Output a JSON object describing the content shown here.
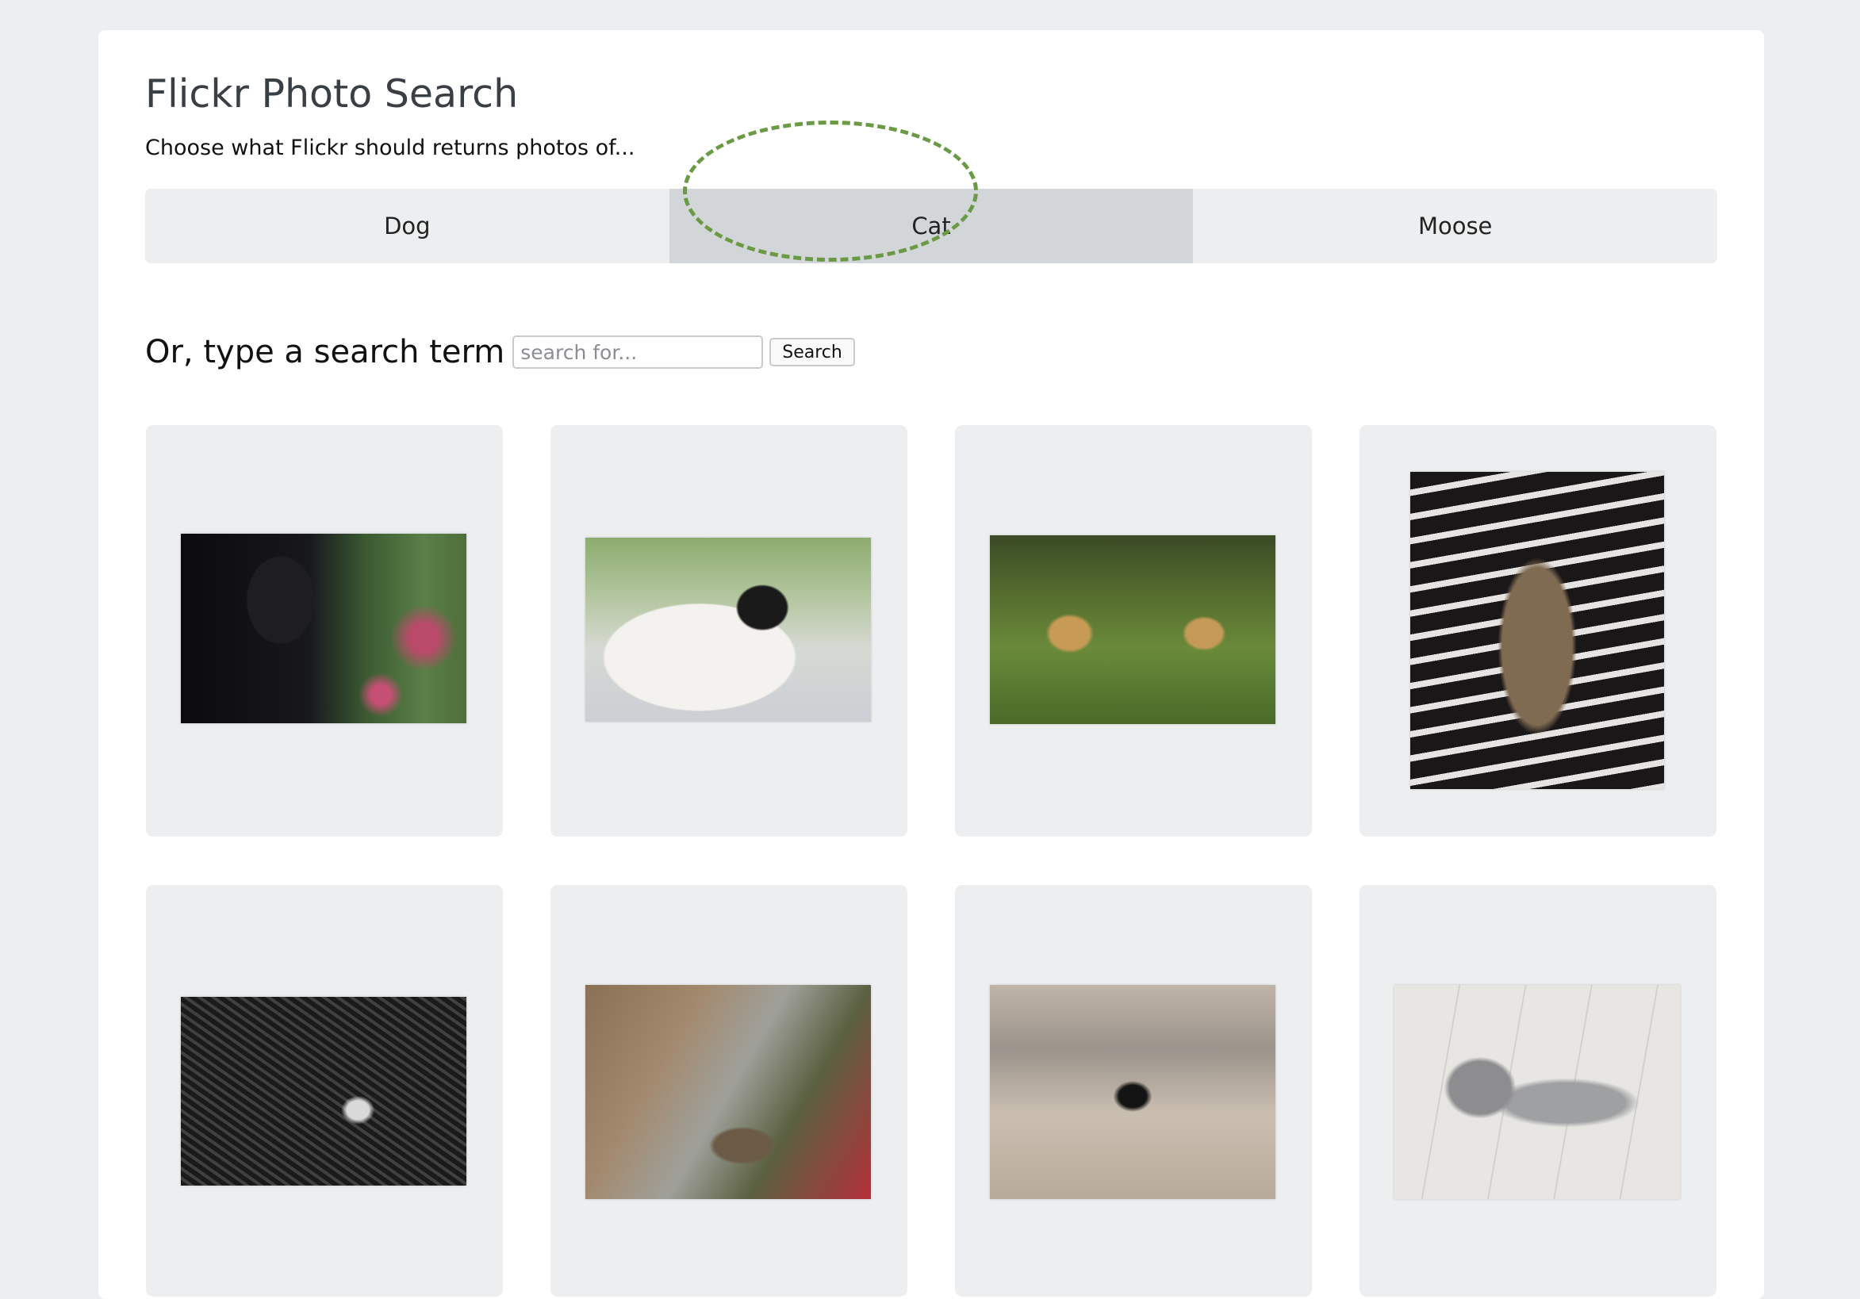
{
  "page": {
    "title": "Flickr Photo Search",
    "subtitle": "Choose what Flickr should returns photos of..."
  },
  "tabs": [
    {
      "label": "Dog",
      "active": false
    },
    {
      "label": "Cat",
      "active": true
    },
    {
      "label": "Moose",
      "active": false
    }
  ],
  "search": {
    "label": "Or, type a search term",
    "placeholder": "search for...",
    "value": "",
    "button_label": "Search"
  },
  "photos": [
    {
      "subject": "black cat"
    },
    {
      "subject": "white and black cat"
    },
    {
      "subject": "two leopards in grass"
    },
    {
      "subject": "tortoiseshell cat on striped blanket"
    },
    {
      "subject": "cat under wicker chair (black and white)"
    },
    {
      "subject": "cat sleeping in a box"
    },
    {
      "subject": "cat paw close-up"
    },
    {
      "subject": "grey cat lying on tiles"
    }
  ],
  "colors": {
    "page_background": "#eceef0",
    "card_background": "#ffffff",
    "active_tab": "#d3d6d9",
    "highlight": "#6b9a45"
  }
}
